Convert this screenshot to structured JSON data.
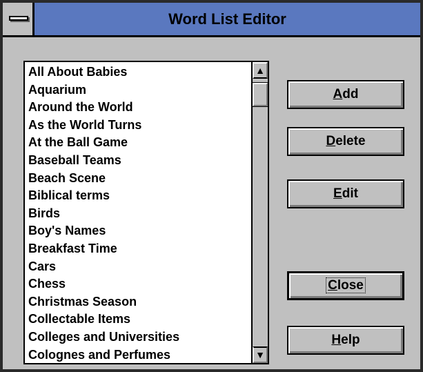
{
  "window": {
    "title": "Word List Editor"
  },
  "word_list": {
    "items": [
      "All About Babies",
      "Aquarium",
      "Around the World",
      "As the World Turns",
      "At the Ball Game",
      "Baseball Teams",
      "Beach Scene",
      "Biblical terms",
      "Birds",
      "Boy's Names",
      "Breakfast Time",
      "Cars",
      "Chess",
      "Christmas Season",
      "Collectable Items",
      "Colleges and Universities",
      "Colognes and Perfumes"
    ],
    "scroll_up_icon": "up-arrow-icon",
    "scroll_down_icon": "down-arrow-icon"
  },
  "buttons": {
    "add": {
      "mnemonic": "A",
      "rest": "dd"
    },
    "delete": {
      "mnemonic": "D",
      "rest": "elete"
    },
    "edit": {
      "mnemonic": "E",
      "rest": "dit"
    },
    "close": {
      "mnemonic": "C",
      "rest": "lose"
    },
    "help": {
      "mnemonic": "H",
      "rest": "elp"
    }
  },
  "colors": {
    "titlebar": "#5a78bf",
    "face": "#c0c0c0"
  }
}
